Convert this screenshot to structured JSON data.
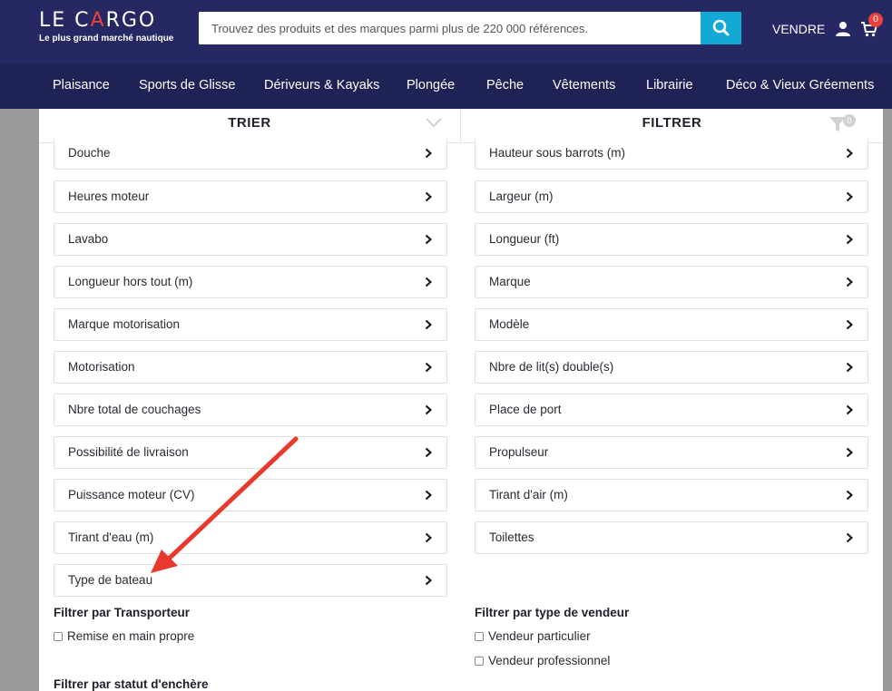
{
  "header": {
    "logo_title_a": "LE C",
    "logo_title_tri": "A",
    "logo_title_b": "RGO",
    "logo_sub": "Le plus grand marché nautique",
    "search_placeholder": "Trouvez des produits et des marques parmi plus de 220 000 références.",
    "sell": "VENDRE",
    "cart_count": "0"
  },
  "nav": [
    "Plaisance",
    "Sports de Glisse",
    "Dériveurs & Kayaks",
    "Plongée",
    "Pêche",
    "Vêtements",
    "Librairie",
    "Déco & Vieux Gréements"
  ],
  "tabs": {
    "sort": "TRIER",
    "filter": "FILTRER",
    "filter_count": "0"
  },
  "filters_left": [
    "Douche",
    "Heures moteur",
    "Lavabo",
    "Longueur hors tout (m)",
    "Marque motorisation",
    "Motorisation",
    "Nbre total de couchages",
    "Possibilité de livraison",
    "Puissance moteur (CV)",
    "Tirant d'eau (m)",
    "Type de bateau"
  ],
  "filters_right": [
    "Hauteur sous barrots (m)",
    "Largeur (m)",
    "Longueur (ft)",
    "Marque",
    "Modèle",
    "Nbre de lit(s) double(s)",
    "Place de port",
    "Propulseur",
    "Tirant d'air (m)",
    "Toilettes"
  ],
  "transporteur": {
    "title": "Filtrer par Transporteur",
    "options": [
      "Remise en main propre"
    ]
  },
  "vendeur": {
    "title": "Filtrer par type de vendeur",
    "options": [
      "Vendeur particulier",
      "Vendeur professionnel"
    ]
  },
  "enchere": {
    "title": "Filtrer par statut d'enchère"
  },
  "colors": {
    "header_bg": "#252862",
    "nav_bg": "#1f2255",
    "search_btn": "#13a9d6",
    "badge": "#e8423a",
    "arrow": "#e8392c"
  }
}
